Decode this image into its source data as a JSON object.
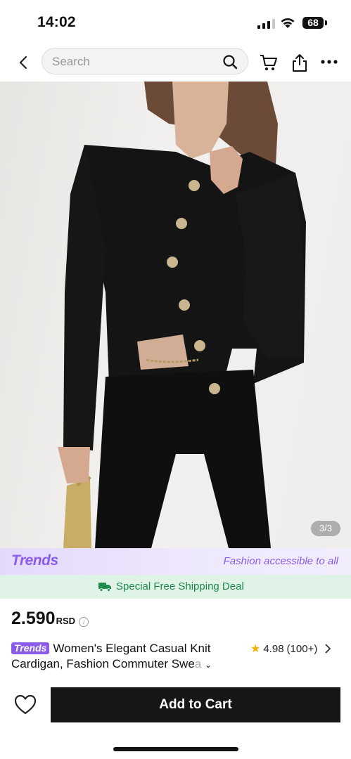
{
  "status_bar": {
    "time": "14:02",
    "battery": "68"
  },
  "search": {
    "placeholder": "Search"
  },
  "gallery": {
    "counter": "3/3"
  },
  "trends_banner": {
    "logo": "Trends",
    "tagline": "Fashion accessible to all"
  },
  "shipping": {
    "label": "Special Free Shipping Deal"
  },
  "price": {
    "amount": "2.590",
    "currency": "RSD"
  },
  "product": {
    "badge": "Trends",
    "title_main": "Women's Elegant Casual Knit Cardigan, Fashion Commuter Swe",
    "title_fade": "a",
    "rating": "4.98",
    "review_count": "(100+)"
  },
  "actions": {
    "add_to_cart": "Add to Cart"
  },
  "colors": {
    "accent_purple": "#8a5ce9",
    "shipping_green": "#1f8a4c",
    "button_dark": "#161616"
  }
}
